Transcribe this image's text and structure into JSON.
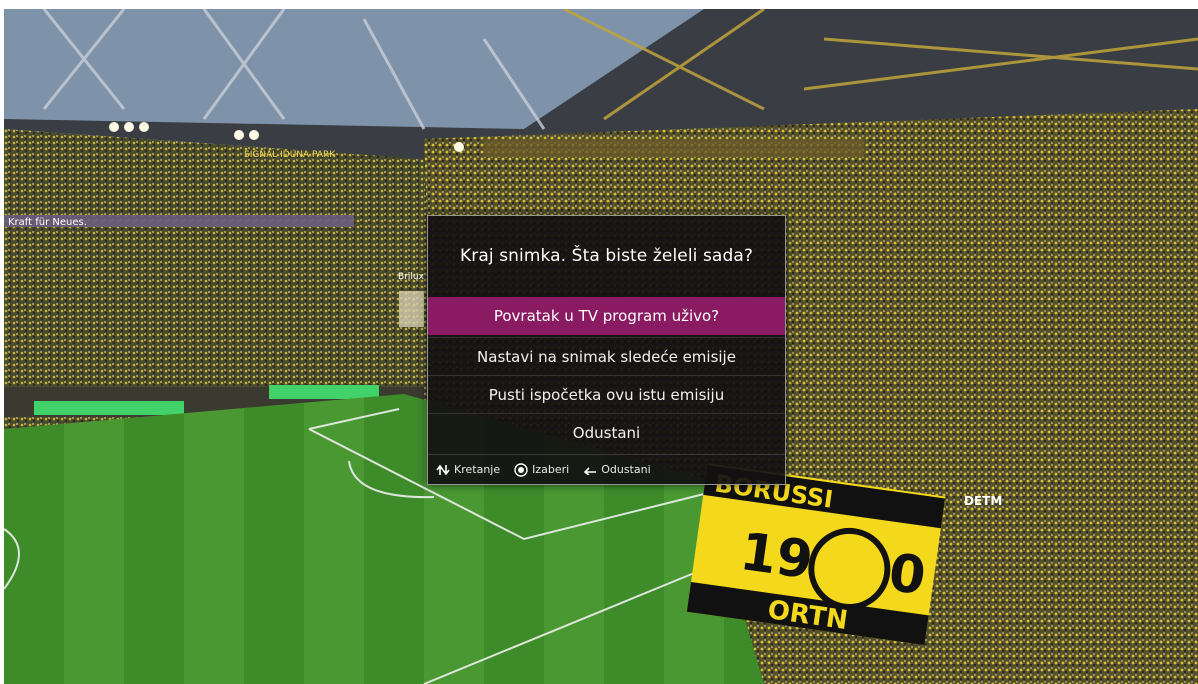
{
  "dialog": {
    "title": "Kraj snimka. Šta biste želeli sada?",
    "options": [
      {
        "label": "Povratak u TV program uživo?",
        "selected": true
      },
      {
        "label": "Nastavi na snimak sledeće emisije",
        "selected": false
      },
      {
        "label": "Pusti ispočetka ovu istu emisiju",
        "selected": false
      },
      {
        "label": "Odustani",
        "selected": false
      }
    ],
    "hints": [
      {
        "icon": "navigate-arrows-icon",
        "label": "Kretanje"
      },
      {
        "icon": "ok-button-icon",
        "label": "Izaberi"
      },
      {
        "icon": "back-arrow-icon",
        "label": "Odustani"
      }
    ],
    "accent_color": "#8a1a62"
  },
  "background": {
    "banner_left": "Kraft für Neues.",
    "banner_center": "SIGNAL IDUNA PARK",
    "flag_top": "BORUSSI",
    "flag_number_left": "19",
    "flag_number_right": "0",
    "flag_bottom": "ORTN",
    "billboard": "Brilux",
    "ad_right": "DETM"
  }
}
